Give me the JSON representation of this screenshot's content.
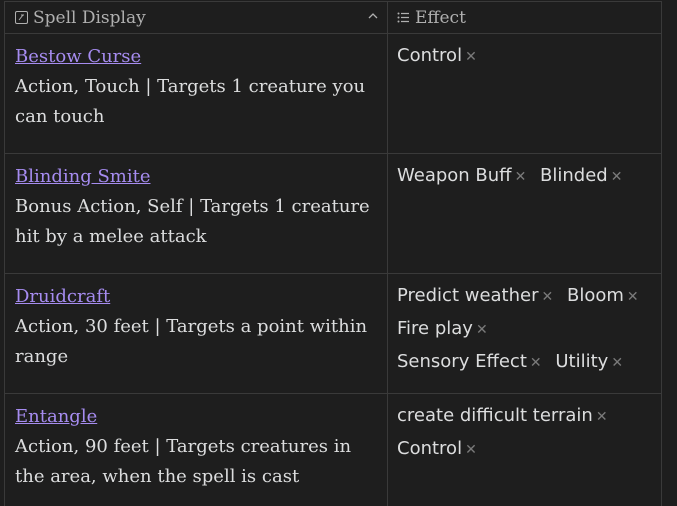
{
  "header": {
    "spell_display_label": "Spell Display",
    "effect_label": "Effect"
  },
  "rows": [
    {
      "name": "Bestow Curse",
      "description": "Action, Touch | Targets 1 creature you can touch",
      "effects": [
        "Control"
      ]
    },
    {
      "name": "Blinding Smite",
      "description": "Bonus Action, Self | Targets 1 creature hit by a melee attack",
      "effects": [
        "Weapon Buff",
        "Blinded"
      ]
    },
    {
      "name": "Druidcraft",
      "description": "Action, 30 feet | Targets a point within range",
      "effects": [
        "Predict weather",
        "Bloom",
        "Fire play",
        "Sensory Effect",
        "Utility"
      ]
    },
    {
      "name": "Entangle",
      "description": "Action, 90 feet | Targets creatures in the area, when the spell is cast",
      "effects": [
        "create difficult terrain",
        "Control"
      ]
    }
  ],
  "icons": {
    "spell_display": "text-field-icon",
    "effect": "list-icon",
    "sort": "chevron-up-icon",
    "remove": "close-icon"
  },
  "colors": {
    "background": "#1e1e1e",
    "link": "#a68cf0",
    "border": "#3a3a3a"
  }
}
